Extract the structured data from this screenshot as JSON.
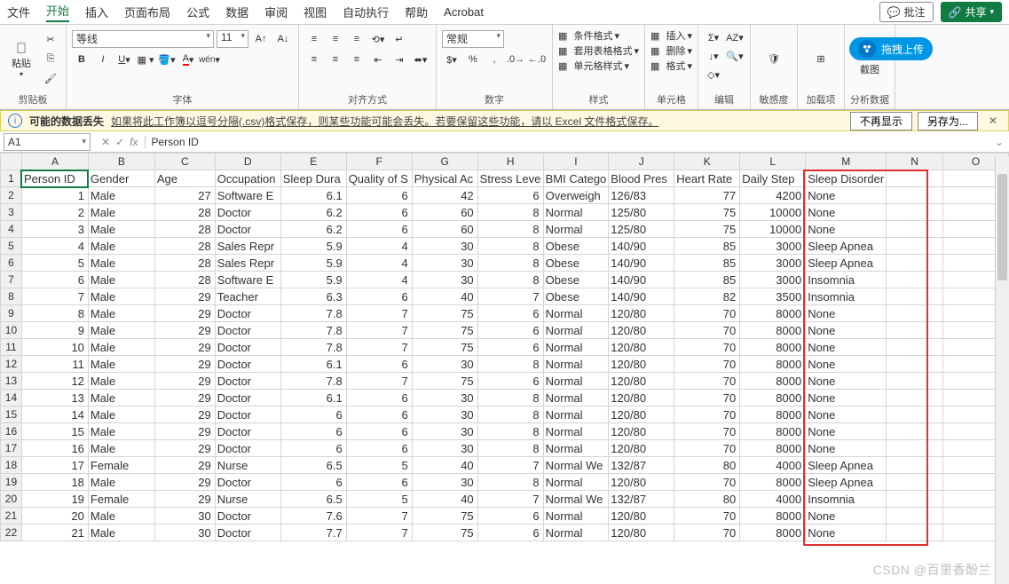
{
  "menu": {
    "items": [
      "文件",
      "开始",
      "插入",
      "页面布局",
      "公式",
      "数据",
      "审阅",
      "视图",
      "自动执行",
      "帮助",
      "Acrobat"
    ],
    "active": 1,
    "comment": "批注",
    "share": "共享"
  },
  "ribbon": {
    "clipboard": "剪贴板",
    "paste": "粘贴",
    "font_group": "字体",
    "font_name": "等线",
    "font_size": "11",
    "align": "对齐方式",
    "number_group": "数字",
    "number_fmt": "常规",
    "styles": "样式",
    "cf": "条件格式",
    "fmt_tbl": "套用表格格式",
    "cell_styles": "单元格样式",
    "cells": "单元格",
    "insert": "插入",
    "delete": "删除",
    "format": "格式",
    "editing": "编辑",
    "sensitivity": "敏感度",
    "addins": "加载项",
    "analysis": "分析数据",
    "screenshot": "截图"
  },
  "pill": {
    "label": "拖拽上传"
  },
  "warning": {
    "title": "可能的数据丢失",
    "msg": "如果将此工作簿以逗号分隔(.csv)格式保存，则某些功能可能会丢失。若要保留这些功能，请以 Excel 文件格式保存。",
    "btn1": "不再显示",
    "btn2": "另存为..."
  },
  "fx": {
    "cell": "A1",
    "value": "Person ID"
  },
  "cols": [
    "A",
    "B",
    "C",
    "D",
    "E",
    "F",
    "G",
    "H",
    "I",
    "J",
    "K",
    "L",
    "M",
    "N",
    "O"
  ],
  "headers": [
    "Person ID",
    "Gender",
    "Age",
    "Occupation",
    "Sleep Duration",
    "Quality of Sleep",
    "Physical Activity",
    "Stress Level",
    "BMI Category",
    "Blood Pressure",
    "Heart Rate",
    "Daily Steps",
    "Sleep Disorder"
  ],
  "headers_disp": [
    "Person ID",
    "Gender",
    "Age",
    "Occupation",
    "Sleep Dura",
    "Quality of S",
    "Physical Ac",
    "Stress Leve",
    "BMI Catego",
    "Blood Pres",
    "Heart Rate",
    "Daily Step",
    "Sleep Disorder"
  ],
  "rows": [
    [
      1,
      "Male",
      27,
      "Software E",
      6.1,
      6,
      42,
      6,
      "Overweigh",
      "126/83",
      77,
      4200,
      "None"
    ],
    [
      2,
      "Male",
      28,
      "Doctor",
      6.2,
      6,
      60,
      8,
      "Normal",
      "125/80",
      75,
      10000,
      "None"
    ],
    [
      3,
      "Male",
      28,
      "Doctor",
      6.2,
      6,
      60,
      8,
      "Normal",
      "125/80",
      75,
      10000,
      "None"
    ],
    [
      4,
      "Male",
      28,
      "Sales Repr",
      5.9,
      4,
      30,
      8,
      "Obese",
      "140/90",
      85,
      3000,
      "Sleep Apnea"
    ],
    [
      5,
      "Male",
      28,
      "Sales Repr",
      5.9,
      4,
      30,
      8,
      "Obese",
      "140/90",
      85,
      3000,
      "Sleep Apnea"
    ],
    [
      6,
      "Male",
      28,
      "Software E",
      5.9,
      4,
      30,
      8,
      "Obese",
      "140/90",
      85,
      3000,
      "Insomnia"
    ],
    [
      7,
      "Male",
      29,
      "Teacher",
      6.3,
      6,
      40,
      7,
      "Obese",
      "140/90",
      82,
      3500,
      "Insomnia"
    ],
    [
      8,
      "Male",
      29,
      "Doctor",
      7.8,
      7,
      75,
      6,
      "Normal",
      "120/80",
      70,
      8000,
      "None"
    ],
    [
      9,
      "Male",
      29,
      "Doctor",
      7.8,
      7,
      75,
      6,
      "Normal",
      "120/80",
      70,
      8000,
      "None"
    ],
    [
      10,
      "Male",
      29,
      "Doctor",
      7.8,
      7,
      75,
      6,
      "Normal",
      "120/80",
      70,
      8000,
      "None"
    ],
    [
      11,
      "Male",
      29,
      "Doctor",
      6.1,
      6,
      30,
      8,
      "Normal",
      "120/80",
      70,
      8000,
      "None"
    ],
    [
      12,
      "Male",
      29,
      "Doctor",
      7.8,
      7,
      75,
      6,
      "Normal",
      "120/80",
      70,
      8000,
      "None"
    ],
    [
      13,
      "Male",
      29,
      "Doctor",
      6.1,
      6,
      30,
      8,
      "Normal",
      "120/80",
      70,
      8000,
      "None"
    ],
    [
      14,
      "Male",
      29,
      "Doctor",
      6,
      6,
      30,
      8,
      "Normal",
      "120/80",
      70,
      8000,
      "None"
    ],
    [
      15,
      "Male",
      29,
      "Doctor",
      6,
      6,
      30,
      8,
      "Normal",
      "120/80",
      70,
      8000,
      "None"
    ],
    [
      16,
      "Male",
      29,
      "Doctor",
      6,
      6,
      30,
      8,
      "Normal",
      "120/80",
      70,
      8000,
      "None"
    ],
    [
      17,
      "Female",
      29,
      "Nurse",
      6.5,
      5,
      40,
      7,
      "Normal We",
      "132/87",
      80,
      4000,
      "Sleep Apnea"
    ],
    [
      18,
      "Male",
      29,
      "Doctor",
      6,
      6,
      30,
      8,
      "Normal",
      "120/80",
      70,
      8000,
      "Sleep Apnea"
    ],
    [
      19,
      "Female",
      29,
      "Nurse",
      6.5,
      5,
      40,
      7,
      "Normal We",
      "132/87",
      80,
      4000,
      "Insomnia"
    ],
    [
      20,
      "Male",
      30,
      "Doctor",
      7.6,
      7,
      75,
      6,
      "Normal",
      "120/80",
      70,
      8000,
      "None"
    ],
    [
      21,
      "Male",
      30,
      "Doctor",
      7.7,
      7,
      75,
      6,
      "Normal",
      "120/80",
      70,
      8000,
      "None"
    ]
  ],
  "watermark": "CSDN @百里香酚兰"
}
